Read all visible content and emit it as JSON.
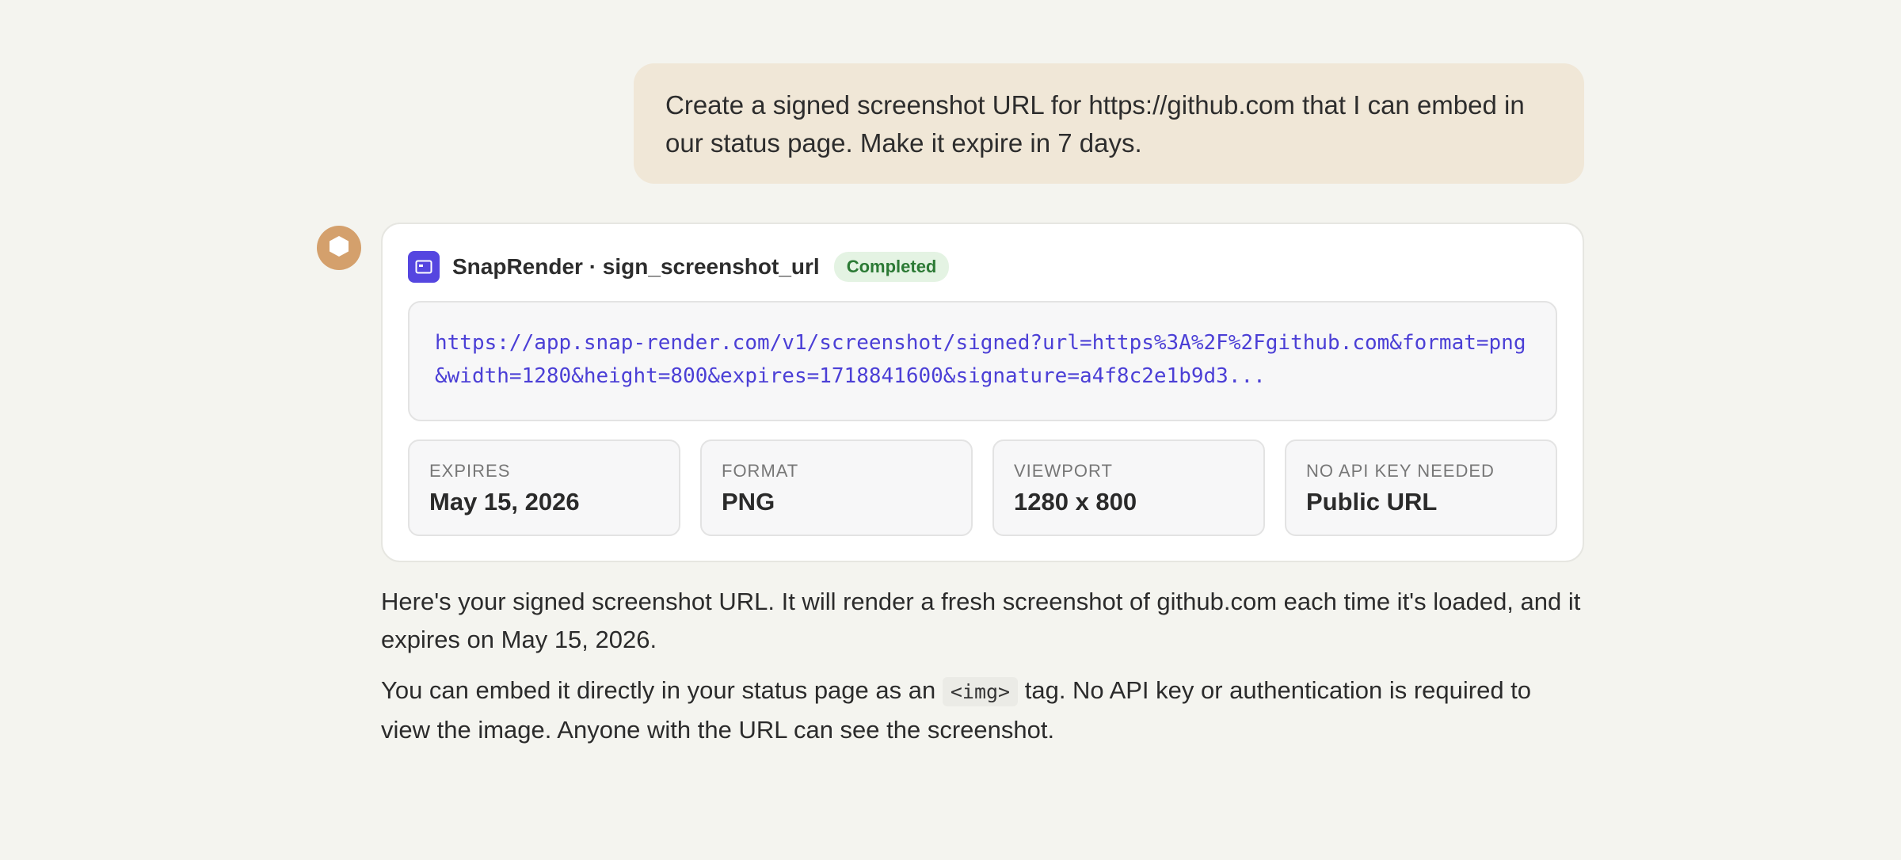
{
  "user_message": {
    "text": "Create a signed screenshot URL for https://github.com that I can embed in our status page. Make it expire in 7 days."
  },
  "assistant": {
    "avatar_icon": "hexagon-icon",
    "avatar_color": "#d4a06c"
  },
  "tool_call": {
    "icon": "screenshot-icon",
    "icon_color": "#5546e0",
    "title": "SnapRender · sign_screenshot_url",
    "status": "Completed",
    "status_color": "#2c7a35",
    "url": "https://app.snap-render.com/v1/screenshot/signed?url=https%3A%2F%2Fgithub.com&format=png&width=1280&height=800&expires=1718841600&signature=a4f8c2e1b9d3...",
    "url_color": "#4b3fd6",
    "meta": [
      {
        "label": "EXPIRES",
        "value": "May 15, 2026"
      },
      {
        "label": "FORMAT",
        "value": "PNG"
      },
      {
        "label": "VIEWPORT",
        "value": "1280 x 800"
      },
      {
        "label": "NO API KEY NEEDED",
        "value": "Public URL"
      }
    ]
  },
  "reply": {
    "paragraph1": "Here's your signed screenshot URL. It will render a fresh screenshot of github.com each time it's loaded, and it expires on May 15, 2026.",
    "paragraph2_before": "You can embed it directly in your status page as an ",
    "paragraph2_code": "<img>",
    "paragraph2_after": " tag. No API key or authentication is required to view the image. Anyone with the URL can see the screenshot."
  }
}
